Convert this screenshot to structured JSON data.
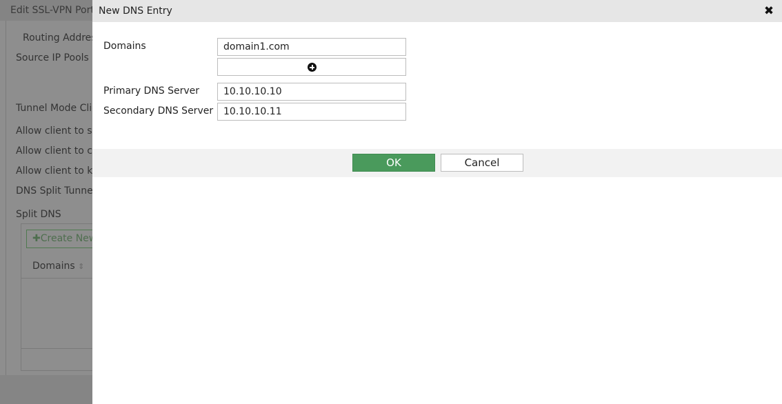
{
  "background": {
    "title": "Edit SSL-VPN Port",
    "labels": {
      "routing_address": "Routing Addres",
      "source_ip_pools": "Source IP Pools",
      "tunnel_mode": "Tunnel Mode Clie",
      "allow_save": "Allow client to sa",
      "allow_connect": "Allow client to co",
      "allow_keep": "Allow client to ke",
      "dns_split_tunnel": "DNS Split Tunnel",
      "split_dns": "Split DNS"
    },
    "create_new_label": "Create New",
    "table_header_domains": "Domains"
  },
  "dialog": {
    "title": "New DNS Entry",
    "close_glyph": "✖",
    "domains_label": "Domains",
    "domains_value": "domain1.com",
    "primary_dns_label": "Primary DNS Server",
    "primary_dns_value": "10.10.10.10",
    "secondary_dns_label": "Secondary DNS Server",
    "secondary_dns_value": "10.10.10.11",
    "ok_label": "OK",
    "cancel_label": "Cancel"
  },
  "colors": {
    "ok_button": "#4a9a5c",
    "dialog_header": "#e6e6e6",
    "overlay": "#8e8e8e"
  }
}
